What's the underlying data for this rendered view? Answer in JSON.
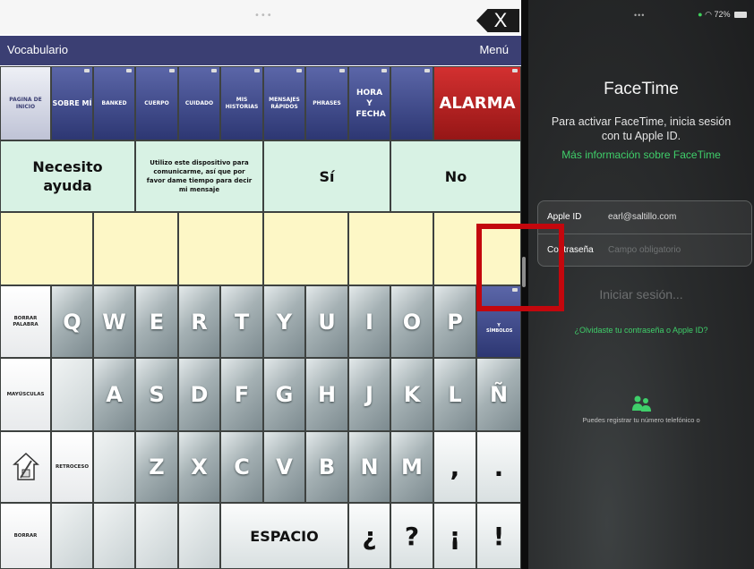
{
  "aac": {
    "close_label": "X",
    "header": {
      "title": "Vocabulario",
      "menu": "Menú"
    },
    "nav": {
      "pagina": "PAGINA DE INICIO",
      "sobre": "SOBRE MÍ",
      "banked": "BANKED",
      "cuerpo": "CUERPO",
      "cuidado": "CUIDADO",
      "historias": "MIS HISTORIAS",
      "mensajes": "MENSAJES RÁPIDOS",
      "phrases": "PHRASES",
      "hora": "HORA Y FECHA",
      "alarma": "ALARMA"
    },
    "phrases": {
      "ayuda": "Necesito ayuda",
      "dispositivo": "Utilizo este dispositivo para comunicarme, así que por favor dame tiempo para decir mi mensaje",
      "si": "Sí",
      "no": "No"
    },
    "side": {
      "borrar_palabra": "BORRAR PALABRA",
      "mayusculas": "MAYÚSCULAS",
      "retroceso": "RETROCESO",
      "borrar": "BORRAR",
      "y_simbolos": "Y SÍMBOLOS"
    },
    "keys": {
      "row1": [
        "Q",
        "W",
        "E",
        "R",
        "T",
        "Y",
        "U",
        "I",
        "O",
        "P"
      ],
      "row2": [
        "A",
        "S",
        "D",
        "F",
        "G",
        "H",
        "J",
        "K",
        "L",
        "Ñ"
      ],
      "row3": [
        "Z",
        "X",
        "C",
        "V",
        "B",
        "N",
        "M",
        ",",
        "."
      ],
      "espacio": "ESPACIO",
      "punct": [
        "¿",
        "?",
        "¡",
        "!"
      ]
    }
  },
  "facetime": {
    "status": {
      "battery": "72%"
    },
    "title": "FaceTime",
    "description": "Para activar FaceTime, inicia sesión con tu Apple ID.",
    "more_info": "Más información sobre FaceTime",
    "apple_id_label": "Apple ID",
    "apple_id_value": "earl@saltillo.com",
    "password_label": "Contraseña",
    "password_placeholder": "Campo obligatorio",
    "signin": "Iniciar sesión...",
    "forgot": "¿Olvidaste tu contraseña o Apple ID?",
    "phone_note": "Puedes registrar tu número telefónico o"
  }
}
